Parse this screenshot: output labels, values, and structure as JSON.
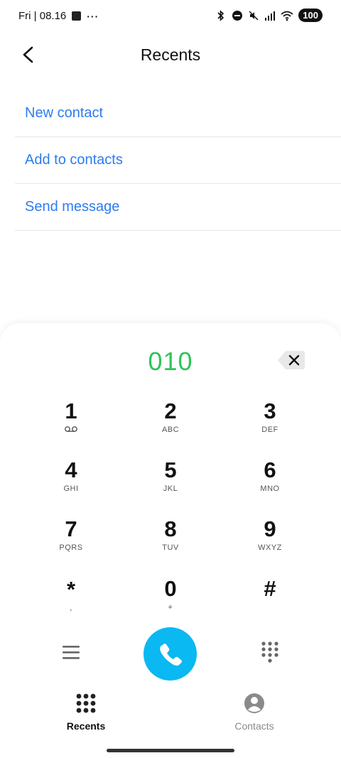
{
  "status_bar": {
    "day_time": "Fri | 08.16",
    "more": "···",
    "battery": "100"
  },
  "header": {
    "title": "Recents"
  },
  "actions": [
    {
      "label": "New contact"
    },
    {
      "label": "Add to contacts"
    },
    {
      "label": "Send message"
    }
  ],
  "dialer": {
    "number": "010",
    "keys": [
      {
        "digit": "1",
        "sub": "ᴑᴑ"
      },
      {
        "digit": "2",
        "sub": "ABC"
      },
      {
        "digit": "3",
        "sub": "DEF"
      },
      {
        "digit": "4",
        "sub": "GHI"
      },
      {
        "digit": "5",
        "sub": "JKL"
      },
      {
        "digit": "6",
        "sub": "MNO"
      },
      {
        "digit": "7",
        "sub": "PQRS"
      },
      {
        "digit": "8",
        "sub": "TUV"
      },
      {
        "digit": "9",
        "sub": "WXYZ"
      },
      {
        "digit": "*",
        "sub": ","
      },
      {
        "digit": "0",
        "sub": "+"
      },
      {
        "digit": "#",
        "sub": ""
      }
    ]
  },
  "tabs": [
    {
      "label": "Recents",
      "active": true
    },
    {
      "label": "Contacts",
      "active": false
    }
  ],
  "colors": {
    "accent_blue": "#2d7cf0",
    "number_green": "#2ec45a",
    "call_button": "#0ab8f2"
  }
}
